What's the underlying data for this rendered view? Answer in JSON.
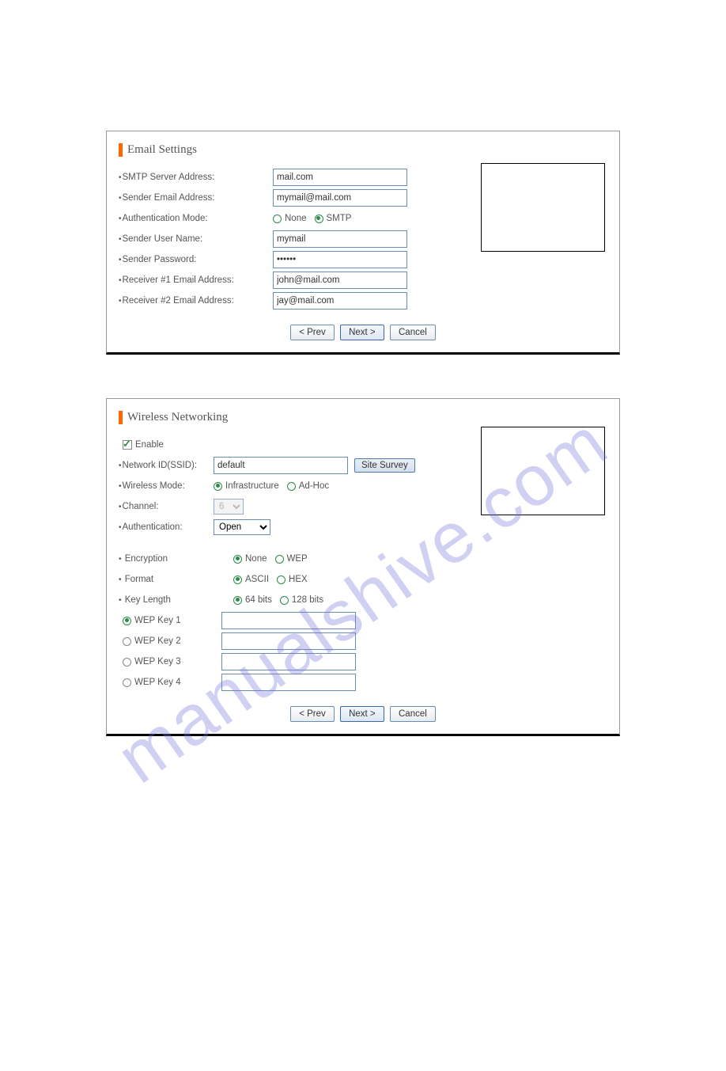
{
  "watermark": "manualshive.com",
  "email": {
    "title": "Email Settings",
    "smtp_label": "SMTP Server Address:",
    "smtp_value": "mail.com",
    "sender_email_label": "Sender Email Address:",
    "sender_email_value": "mymail@mail.com",
    "auth_mode_label": "Authentication Mode:",
    "auth_none": "None",
    "auth_smtp": "SMTP",
    "user_label": "Sender User Name:",
    "user_value": "mymail",
    "pass_label": "Sender Password:",
    "pass_value": "••••••",
    "r1_label": "Receiver #1 Email Address:",
    "r1_value": "john@mail.com",
    "r2_label": "Receiver #2 Email Address:",
    "r2_value": "jay@mail.com"
  },
  "wireless": {
    "title": "Wireless Networking",
    "enable_label": "Enable",
    "ssid_label": "Network ID(SSID):",
    "ssid_value": "default",
    "site_survey": "Site Survey",
    "mode_label": "Wireless Mode:",
    "mode_infra": "Infrastructure",
    "mode_adhoc": "Ad-Hoc",
    "channel_label": "Channel:",
    "channel_value": "6",
    "auth_label": "Authentication:",
    "auth_value": "Open",
    "enc_label": " Encryption",
    "enc_none": "None",
    "enc_wep": "WEP",
    "fmt_label": " Format",
    "fmt_ascii": "ASCII",
    "fmt_hex": "HEX",
    "keylen_label": " Key Length",
    "keylen_64": "64 bits",
    "keylen_128": "128 bits",
    "wep1": "WEP Key 1",
    "wep2": "WEP Key 2",
    "wep3": "WEP Key 3",
    "wep4": "WEP Key 4"
  },
  "buttons": {
    "prev": "< Prev",
    "next": "Next >",
    "cancel": "Cancel"
  }
}
